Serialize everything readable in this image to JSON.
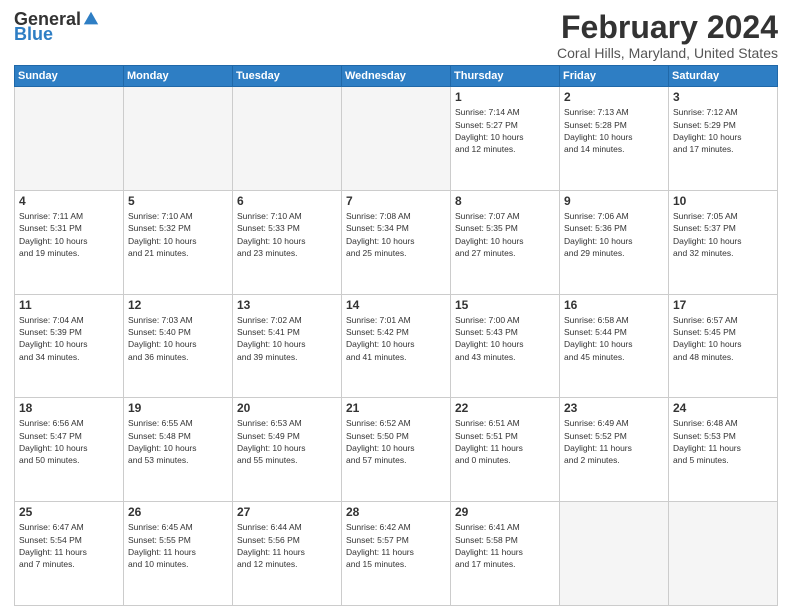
{
  "header": {
    "logo_general": "General",
    "logo_blue": "Blue",
    "title": "February 2024",
    "subtitle": "Coral Hills, Maryland, United States"
  },
  "days_of_week": [
    "Sunday",
    "Monday",
    "Tuesday",
    "Wednesday",
    "Thursday",
    "Friday",
    "Saturday"
  ],
  "weeks": [
    [
      {
        "day": "",
        "info": ""
      },
      {
        "day": "",
        "info": ""
      },
      {
        "day": "",
        "info": ""
      },
      {
        "day": "",
        "info": ""
      },
      {
        "day": "1",
        "info": "Sunrise: 7:14 AM\nSunset: 5:27 PM\nDaylight: 10 hours\nand 12 minutes."
      },
      {
        "day": "2",
        "info": "Sunrise: 7:13 AM\nSunset: 5:28 PM\nDaylight: 10 hours\nand 14 minutes."
      },
      {
        "day": "3",
        "info": "Sunrise: 7:12 AM\nSunset: 5:29 PM\nDaylight: 10 hours\nand 17 minutes."
      }
    ],
    [
      {
        "day": "4",
        "info": "Sunrise: 7:11 AM\nSunset: 5:31 PM\nDaylight: 10 hours\nand 19 minutes."
      },
      {
        "day": "5",
        "info": "Sunrise: 7:10 AM\nSunset: 5:32 PM\nDaylight: 10 hours\nand 21 minutes."
      },
      {
        "day": "6",
        "info": "Sunrise: 7:10 AM\nSunset: 5:33 PM\nDaylight: 10 hours\nand 23 minutes."
      },
      {
        "day": "7",
        "info": "Sunrise: 7:08 AM\nSunset: 5:34 PM\nDaylight: 10 hours\nand 25 minutes."
      },
      {
        "day": "8",
        "info": "Sunrise: 7:07 AM\nSunset: 5:35 PM\nDaylight: 10 hours\nand 27 minutes."
      },
      {
        "day": "9",
        "info": "Sunrise: 7:06 AM\nSunset: 5:36 PM\nDaylight: 10 hours\nand 29 minutes."
      },
      {
        "day": "10",
        "info": "Sunrise: 7:05 AM\nSunset: 5:37 PM\nDaylight: 10 hours\nand 32 minutes."
      }
    ],
    [
      {
        "day": "11",
        "info": "Sunrise: 7:04 AM\nSunset: 5:39 PM\nDaylight: 10 hours\nand 34 minutes."
      },
      {
        "day": "12",
        "info": "Sunrise: 7:03 AM\nSunset: 5:40 PM\nDaylight: 10 hours\nand 36 minutes."
      },
      {
        "day": "13",
        "info": "Sunrise: 7:02 AM\nSunset: 5:41 PM\nDaylight: 10 hours\nand 39 minutes."
      },
      {
        "day": "14",
        "info": "Sunrise: 7:01 AM\nSunset: 5:42 PM\nDaylight: 10 hours\nand 41 minutes."
      },
      {
        "day": "15",
        "info": "Sunrise: 7:00 AM\nSunset: 5:43 PM\nDaylight: 10 hours\nand 43 minutes."
      },
      {
        "day": "16",
        "info": "Sunrise: 6:58 AM\nSunset: 5:44 PM\nDaylight: 10 hours\nand 45 minutes."
      },
      {
        "day": "17",
        "info": "Sunrise: 6:57 AM\nSunset: 5:45 PM\nDaylight: 10 hours\nand 48 minutes."
      }
    ],
    [
      {
        "day": "18",
        "info": "Sunrise: 6:56 AM\nSunset: 5:47 PM\nDaylight: 10 hours\nand 50 minutes."
      },
      {
        "day": "19",
        "info": "Sunrise: 6:55 AM\nSunset: 5:48 PM\nDaylight: 10 hours\nand 53 minutes."
      },
      {
        "day": "20",
        "info": "Sunrise: 6:53 AM\nSunset: 5:49 PM\nDaylight: 10 hours\nand 55 minutes."
      },
      {
        "day": "21",
        "info": "Sunrise: 6:52 AM\nSunset: 5:50 PM\nDaylight: 10 hours\nand 57 minutes."
      },
      {
        "day": "22",
        "info": "Sunrise: 6:51 AM\nSunset: 5:51 PM\nDaylight: 11 hours\nand 0 minutes."
      },
      {
        "day": "23",
        "info": "Sunrise: 6:49 AM\nSunset: 5:52 PM\nDaylight: 11 hours\nand 2 minutes."
      },
      {
        "day": "24",
        "info": "Sunrise: 6:48 AM\nSunset: 5:53 PM\nDaylight: 11 hours\nand 5 minutes."
      }
    ],
    [
      {
        "day": "25",
        "info": "Sunrise: 6:47 AM\nSunset: 5:54 PM\nDaylight: 11 hours\nand 7 minutes."
      },
      {
        "day": "26",
        "info": "Sunrise: 6:45 AM\nSunset: 5:55 PM\nDaylight: 11 hours\nand 10 minutes."
      },
      {
        "day": "27",
        "info": "Sunrise: 6:44 AM\nSunset: 5:56 PM\nDaylight: 11 hours\nand 12 minutes."
      },
      {
        "day": "28",
        "info": "Sunrise: 6:42 AM\nSunset: 5:57 PM\nDaylight: 11 hours\nand 15 minutes."
      },
      {
        "day": "29",
        "info": "Sunrise: 6:41 AM\nSunset: 5:58 PM\nDaylight: 11 hours\nand 17 minutes."
      },
      {
        "day": "",
        "info": ""
      },
      {
        "day": "",
        "info": ""
      }
    ]
  ]
}
